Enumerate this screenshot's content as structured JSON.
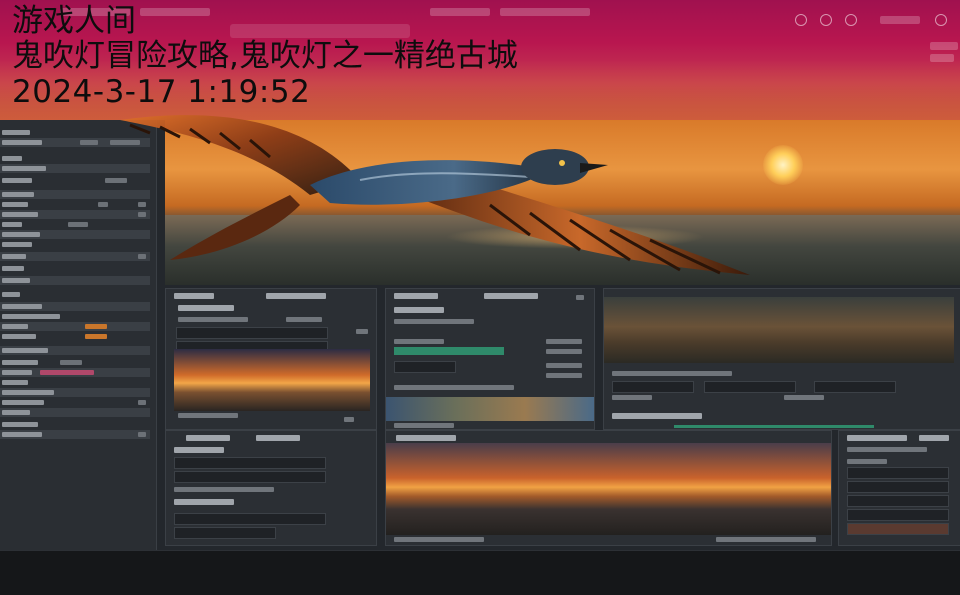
{
  "overlay": {
    "site_name": "游戏人间",
    "headline": "鬼吹灯冒险攻略,鬼吹灯之一精绝古城",
    "timestamp": "2024-3-17 1:19:52"
  },
  "colors": {
    "top_bar": "#b8164f",
    "sidebar_bg": "#2a2e33",
    "panel_bg": "#2b2f34",
    "accent_orange": "#c9762b",
    "accent_green": "#2f8a6a",
    "text_overlay": "#0d0d0d"
  },
  "icons": [
    "bird-icon",
    "close-icon",
    "minimize-icon",
    "settings-icon"
  ]
}
